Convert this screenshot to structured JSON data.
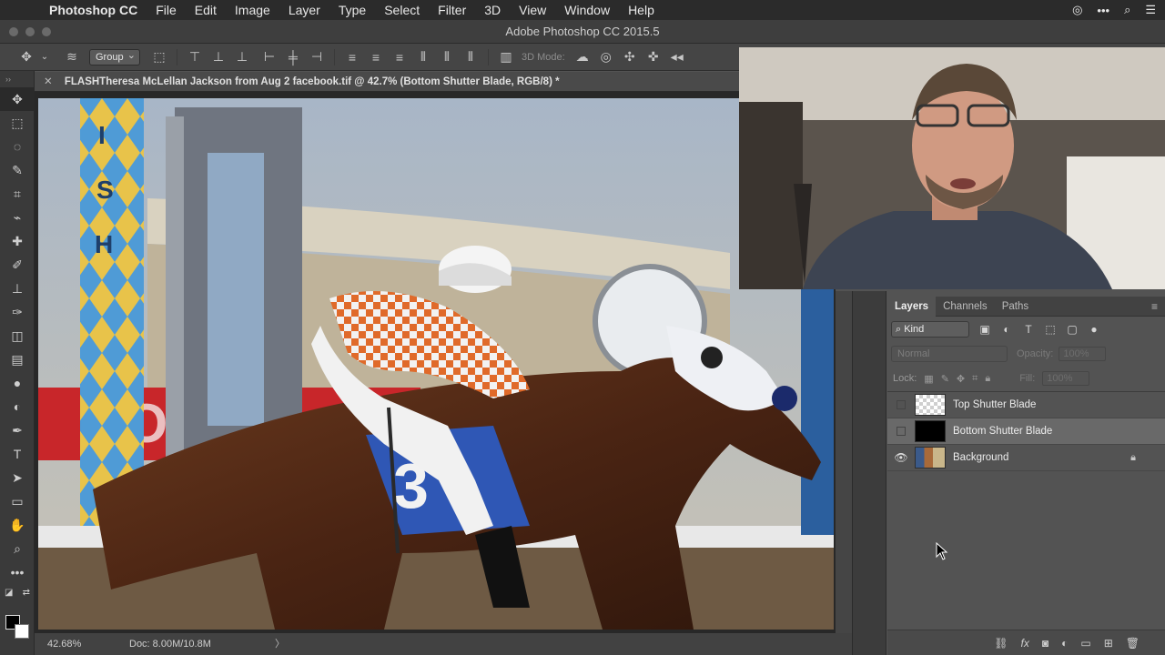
{
  "menubar": {
    "app_name": "Photoshop CC",
    "items": [
      "File",
      "Edit",
      "Image",
      "Layer",
      "Type",
      "Select",
      "Filter",
      "3D",
      "View",
      "Window",
      "Help"
    ]
  },
  "window": {
    "title": "Adobe Photoshop CC 2015.5"
  },
  "options_bar": {
    "auto_select": "Group",
    "mode_label": "3D Mode:"
  },
  "document": {
    "tab_title": "FLASHTheresa McLellan Jackson from Aug 2 facebook.tif @ 42.7% (Bottom Shutter Blade, RGB/8) *",
    "zoom": "42.68%",
    "doc_size": "Doc: 8.00M/10.8M",
    "arrow": "〉"
  },
  "layers_panel": {
    "tabs": [
      "Layers",
      "Channels",
      "Paths"
    ],
    "filter_kind": "Kind",
    "blend_mode": "Normal",
    "opacity_label": "Opacity:",
    "opacity_value": "100%",
    "lock_label": "Lock:",
    "fill_label": "Fill:",
    "fill_value": "100%",
    "layers": [
      {
        "name": "Top Shutter Blade",
        "visible": false,
        "thumb": "checker",
        "selected": false,
        "locked": false
      },
      {
        "name": "Bottom Shutter Blade",
        "visible": false,
        "thumb": "black",
        "selected": true,
        "locked": false
      },
      {
        "name": "Background",
        "visible": true,
        "thumb": "photo",
        "selected": false,
        "locked": true
      }
    ]
  },
  "colors": {
    "accent_selected": "#696969",
    "foreground": "#000000",
    "background": "#ffffff"
  }
}
